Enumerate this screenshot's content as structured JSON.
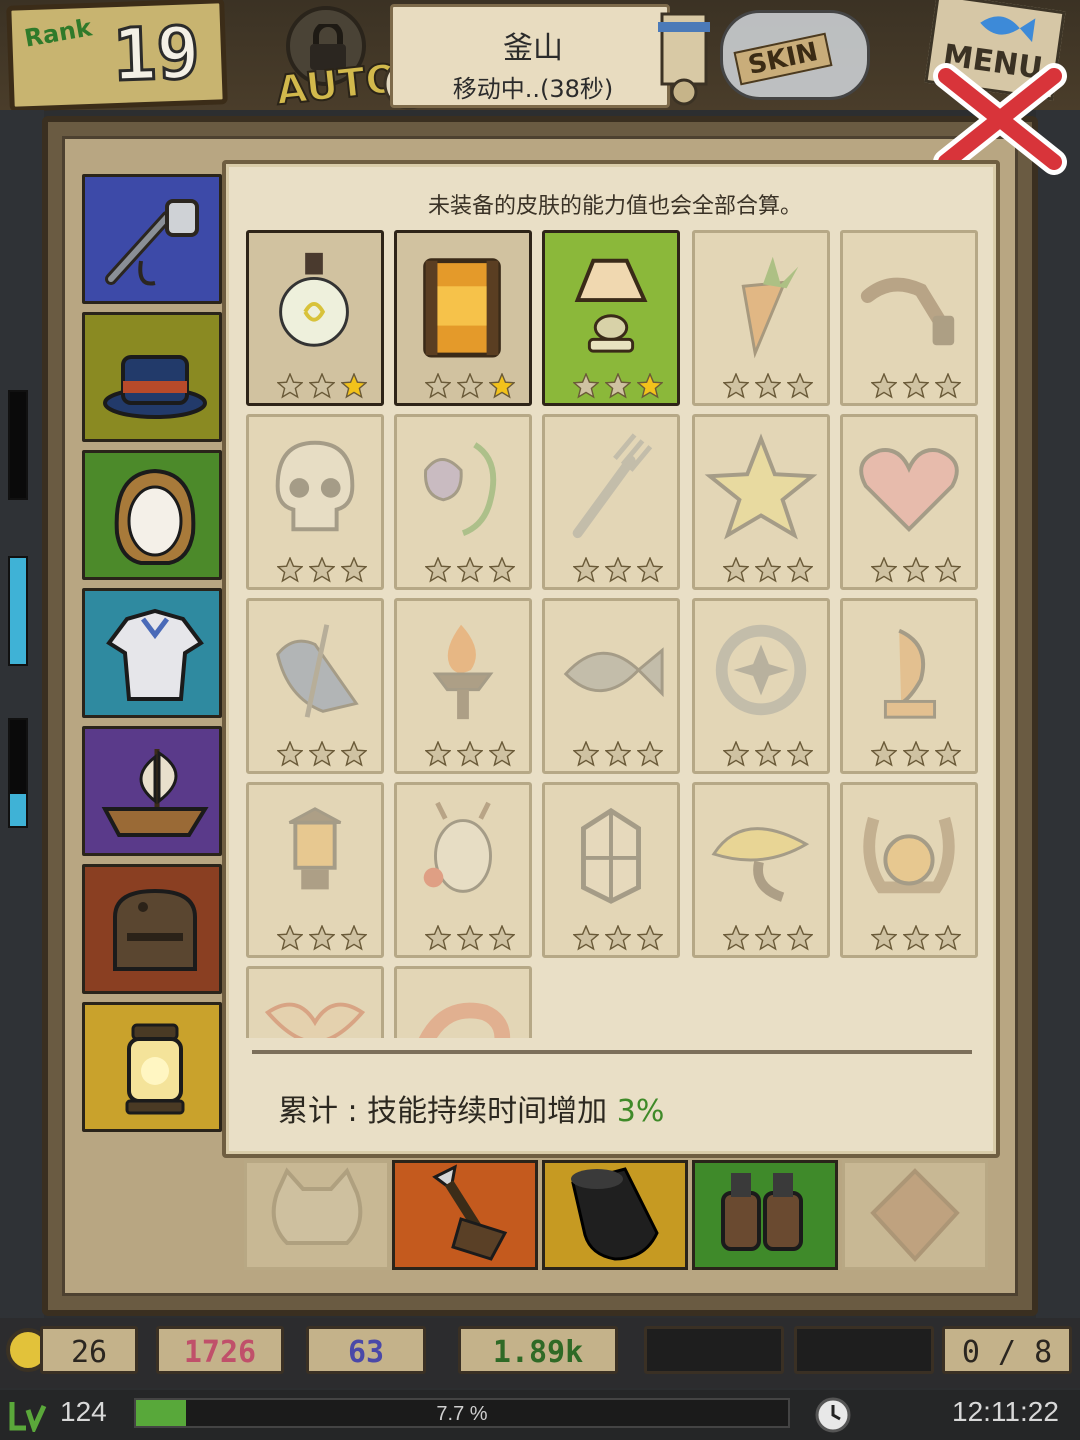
{
  "hud": {
    "rank_label": "Rank",
    "rank_value": "19",
    "auto_label": "AUTO",
    "location": "釜山",
    "status": "移动中..(38秒)",
    "skin_label": "SKIN",
    "menu_label": "MENU"
  },
  "tabs": [
    {
      "id": "fishing-gear",
      "icon": "fishing-rod-icon",
      "color": "#3d4aa8"
    },
    {
      "id": "hat",
      "icon": "top-hat-icon",
      "color": "#8a8a22"
    },
    {
      "id": "hair",
      "icon": "hair-icon",
      "color": "#4c8a2a"
    },
    {
      "id": "clothes",
      "icon": "shirt-icon",
      "color": "#2f8aa0"
    },
    {
      "id": "boat",
      "icon": "boat-icon",
      "color": "#5a3a8a"
    },
    {
      "id": "bag",
      "icon": "backpack-icon",
      "color": "#8a3f22"
    },
    {
      "id": "lantern",
      "icon": "lantern-icon",
      "color": "#c9a22c",
      "selected": true
    }
  ],
  "panel": {
    "notice": "未装备的皮肤的能力值也会全部合算。",
    "summary_label": "累计 : 技能持续时间增加",
    "summary_value": "3%"
  },
  "skins": [
    {
      "icon": "lightbulb-icon",
      "state": "owned",
      "stars": 1
    },
    {
      "icon": "amber-lantern-icon",
      "state": "owned",
      "stars": 1
    },
    {
      "icon": "table-lamp-icon",
      "state": "equipped",
      "stars": 1
    },
    {
      "icon": "carrot-icon",
      "state": "locked",
      "stars": 0
    },
    {
      "icon": "pipe-icon",
      "state": "locked",
      "stars": 0
    },
    {
      "icon": "skull-icon",
      "state": "locked",
      "stars": 0
    },
    {
      "icon": "bellflower-icon",
      "state": "locked",
      "stars": 0
    },
    {
      "icon": "fork-icon",
      "state": "locked",
      "stars": 0
    },
    {
      "icon": "star-icon",
      "state": "locked",
      "stars": 0
    },
    {
      "icon": "heart-icon",
      "state": "locked",
      "stars": 0
    },
    {
      "icon": "bird-icon",
      "state": "locked",
      "stars": 0
    },
    {
      "icon": "torch-icon",
      "state": "locked",
      "stars": 0
    },
    {
      "icon": "fish-icon",
      "state": "locked",
      "stars": 0
    },
    {
      "icon": "ring-icon",
      "state": "locked",
      "stars": 0
    },
    {
      "icon": "fish-statue-icon",
      "state": "locked",
      "stars": 0
    },
    {
      "icon": "street-lamp-icon",
      "state": "locked",
      "stars": 0
    },
    {
      "icon": "reindeer-icon",
      "state": "locked",
      "stars": 0
    },
    {
      "icon": "cage-lantern-icon",
      "state": "locked",
      "stars": 0
    },
    {
      "icon": "mushroom-lamp-icon",
      "state": "locked",
      "stars": 0
    },
    {
      "icon": "horseshoe-lantern-icon",
      "state": "locked",
      "stars": 0
    },
    {
      "icon": "winged-icon",
      "state": "locked",
      "stars": 0
    },
    {
      "icon": "shrimp-icon",
      "state": "locked",
      "stars": 0
    }
  ],
  "bottom_slots": [
    {
      "icon": "cat-icon",
      "color": "#c8b894",
      "locked": true
    },
    {
      "icon": "harpoon-icon",
      "color": "#c45a1e"
    },
    {
      "icon": "cannon-icon",
      "color": "#c69a22"
    },
    {
      "icon": "binoculars-icon",
      "color": "#3f8a2a"
    },
    {
      "icon": "gem-icon",
      "color": "#c8b894",
      "locked": true
    }
  ],
  "resources": {
    "medals": "26",
    "gold": "1726",
    "gems": "63",
    "fish": "1.89k",
    "slots": "0 / 8"
  },
  "status": {
    "level": "124",
    "xp_text": "7.7 %",
    "xp_fraction": 0.077,
    "time": "12:11:22"
  },
  "colors": {
    "star_gold": "#f2c21b",
    "star_gray": "#cfc2a2",
    "accent_green": "#3f8a28"
  }
}
